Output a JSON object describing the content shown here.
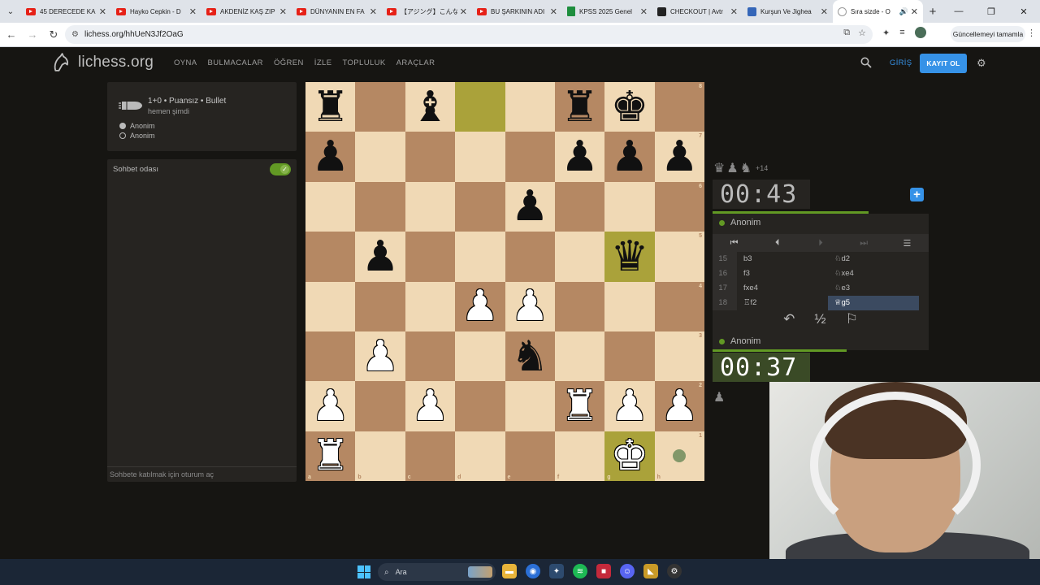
{
  "browser": {
    "tabs": [
      {
        "title": "45 DERECEDE KA",
        "icon": "youtube-icon"
      },
      {
        "title": "Hayko Cepkin - D",
        "icon": "youtube-icon"
      },
      {
        "title": "AKDENİZ KAŞ ZIP",
        "icon": "youtube-icon"
      },
      {
        "title": "DÜNYANIN EN FA",
        "icon": "youtube-icon"
      },
      {
        "title": "【アジング】こんな小",
        "icon": "youtube-icon"
      },
      {
        "title": "BU ŞARKININ ADI",
        "icon": "youtube-icon"
      },
      {
        "title": "KPSS 2025 Genel",
        "icon": "sheets-icon"
      },
      {
        "title": "CHECKOUT | Avtr",
        "icon": "checkout-icon"
      },
      {
        "title": "Kurşun Ve Jighea",
        "icon": "site-icon"
      },
      {
        "title": "Sıra sizde - O",
        "icon": "lichess-icon",
        "active": true
      }
    ],
    "url": "lichess.org/hhUeN3Jf2OaG",
    "update_button": "Güncellemeyi tamamla"
  },
  "header": {
    "logo": "lichess.org",
    "nav": [
      "OYNA",
      "BULMACALAR",
      "ÖĞREN",
      "İZLE",
      "TOPLULUK",
      "ARAÇLAR"
    ],
    "login": "GİRİŞ",
    "signup": "KAYIT OL"
  },
  "game_info": {
    "title": "1+0 • Puansız • Bullet",
    "subtitle": "hemen şimdi",
    "white_player": "Anonim",
    "black_player": "Anonim"
  },
  "chat": {
    "title": "Sohbet odası",
    "placeholder": "Sohbete katılmak için oturum aç"
  },
  "board": {
    "rows": [
      [
        "br",
        "",
        "bb",
        "",
        "",
        "br",
        "bk",
        ""
      ],
      [
        "bp",
        "",
        "",
        "",
        "",
        "bp",
        "bp",
        "bp"
      ],
      [
        "",
        "",
        "",
        "",
        "bp",
        "",
        "",
        ""
      ],
      [
        "",
        "bp",
        "",
        "",
        "",
        "",
        "bq",
        ""
      ],
      [
        "",
        "",
        "",
        "wp",
        "wp",
        "",
        "",
        ""
      ],
      [
        "",
        "wp",
        "",
        "",
        "bn",
        "",
        "",
        ""
      ],
      [
        "wp",
        "",
        "wp",
        "",
        "",
        "wr",
        "wp",
        "wp"
      ],
      [
        "wr",
        "",
        "",
        "",
        "",
        "",
        "wk",
        ""
      ]
    ],
    "ranks": [
      "8",
      "7",
      "6",
      "5",
      "4",
      "3",
      "2",
      "1"
    ],
    "files": [
      "a",
      "b",
      "c",
      "d",
      "e",
      "f",
      "g",
      "h"
    ],
    "highlighted": [
      "d8",
      "g5",
      "g1"
    ],
    "move_dot": "h1"
  },
  "top_player": {
    "material_icons": [
      "queen-icon",
      "pawn-icon",
      "knight-icon"
    ],
    "material_diff": "+14",
    "clock": "00:43",
    "clock_fill": 0.72,
    "name": "Anonim"
  },
  "bottom_player": {
    "name": "Anonim",
    "clock": "00:37",
    "clock_fill": 0.62,
    "material_icons": [
      "pawn-icon"
    ]
  },
  "moves": [
    {
      "num": "15",
      "white": "b3",
      "black": "♘d2"
    },
    {
      "num": "16",
      "white": "f3",
      "black": "♘xe4"
    },
    {
      "num": "17",
      "white": "fxe4",
      "black": "♘e3"
    },
    {
      "num": "18",
      "white": "♖f2",
      "black": "♕g5",
      "current": "black"
    }
  ],
  "actions": {
    "takeback": "↶",
    "draw": "½",
    "resign": "⚐"
  },
  "taskbar": {
    "search": "Ara"
  }
}
